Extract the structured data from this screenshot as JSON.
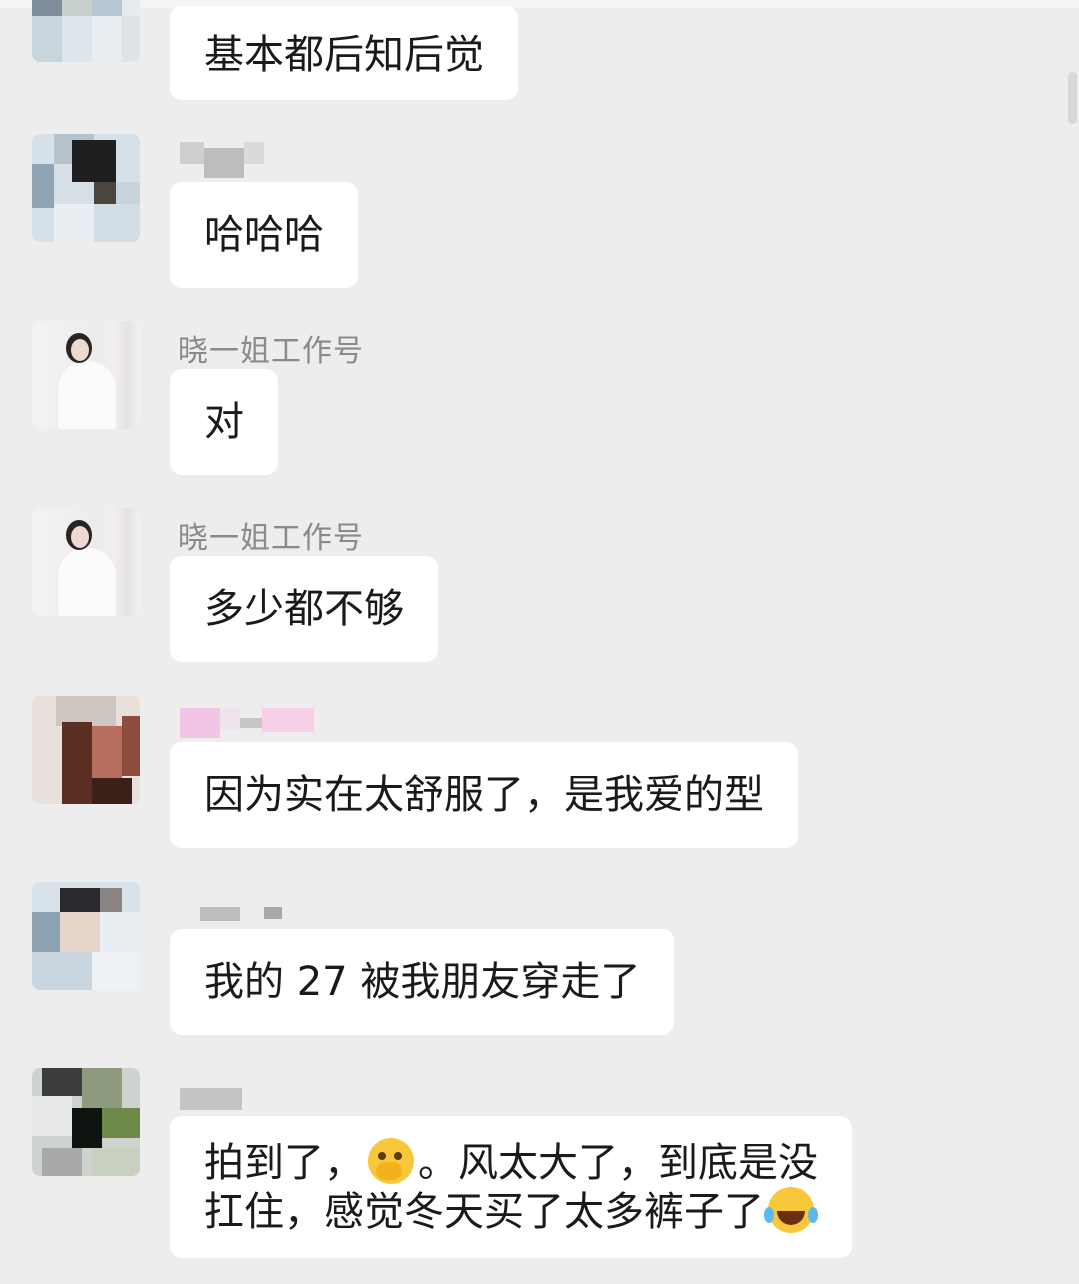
{
  "chat": {
    "messages": [
      {
        "sender": "",
        "text": "基本都后知后觉"
      },
      {
        "sender": "",
        "text": "哈哈哈"
      },
      {
        "sender": "晓一姐工作号",
        "text": "对"
      },
      {
        "sender": "晓一姐工作号",
        "text": "多少都不够"
      },
      {
        "sender": "",
        "text": "因为实在太舒服了，是我爱的型"
      },
      {
        "sender": "",
        "text": "我的 27 被我朋友穿走了"
      },
      {
        "sender": "",
        "line1_a": "拍到了，",
        "line1_b": "。风太大了，到底是没",
        "line2": "扛住，感觉冬天买了太多裤子了",
        "emoji1": "thinking-face-icon",
        "emoji2": "tears-of-joy-icon"
      }
    ]
  },
  "colors": {
    "background": "#ededed",
    "bubble": "#ffffff",
    "name": "#8a8a8a",
    "text": "#1a1a1a"
  }
}
